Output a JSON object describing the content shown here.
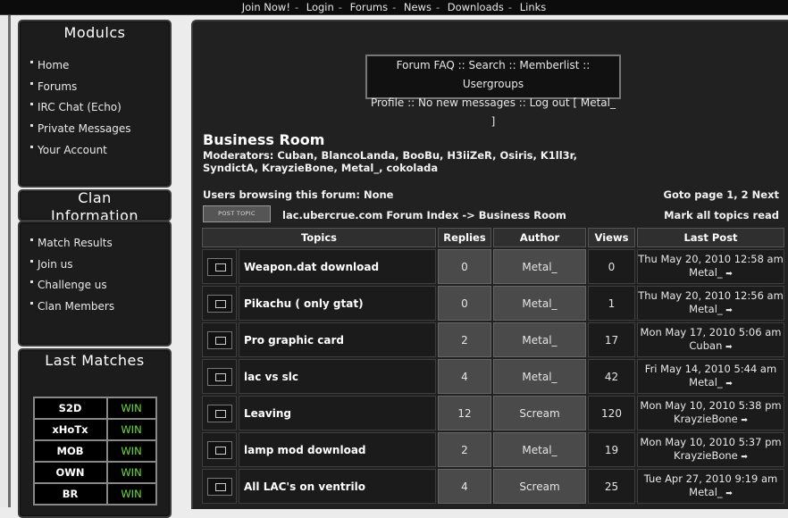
{
  "topnav": [
    "Join Now!",
    "Login",
    "Forums",
    "News",
    "Downloads",
    "Links"
  ],
  "modules": {
    "title": "Modulcs",
    "items": [
      "Home",
      "Forums",
      "IRC Chat (Echo)",
      "Private Messages",
      "Your Account"
    ]
  },
  "clan": {
    "title_line1": "Clan",
    "title_line2": "Information",
    "items": [
      "Match Results",
      "Join us",
      "Challenge us",
      "Clan Members"
    ]
  },
  "last_matches": {
    "title": "Last Matches",
    "rows": [
      {
        "team": "S2D",
        "result": "WIN"
      },
      {
        "team": "xHoTx",
        "result": "WIN"
      },
      {
        "team": "MOB",
        "result": "WIN"
      },
      {
        "team": "OWN",
        "result": "WIN"
      },
      {
        "team": "BR",
        "result": "WIN"
      }
    ]
  },
  "forum_links": {
    "line1": "Forum FAQ :: Search :: Memberlist :: Usergroups",
    "line2": "Profile :: No new messages :: Log out [ Metal_ ]"
  },
  "forum": {
    "title": "Business Room",
    "moderators": "Moderators: Cuban, BlancoLanda, BooBu, H3iiZeR, Osiris, K1ll3r, SyndictA, KrayzieBone, Metal_, cokolada",
    "users_browsing": "Users browsing this forum: None",
    "goto": "Goto page 1, 2  Next",
    "post_topic": "POST TOPIC",
    "breadcrumb": "lac.ubercrue.com Forum Index -> Business Room",
    "mark_all": "Mark all topics read"
  },
  "table": {
    "headers": [
      "Topics",
      "Replies",
      "Author",
      "Views",
      "Last Post"
    ],
    "rows": [
      {
        "title": "Weapon.dat download",
        "replies": "0",
        "author": "Metal_",
        "views": "0",
        "last_date": "Thu May 20, 2010 12:58 am",
        "last_user": "Metal_"
      },
      {
        "title": "Pikachu ( only gtat)",
        "replies": "0",
        "author": "Metal_",
        "views": "1",
        "last_date": "Thu May 20, 2010 12:56 am",
        "last_user": "Metal_"
      },
      {
        "title": "Pro graphic card",
        "replies": "2",
        "author": "Metal_",
        "views": "17",
        "last_date": "Mon May 17, 2010 5:06 am",
        "last_user": "Cuban"
      },
      {
        "title": "lac vs slc",
        "replies": "4",
        "author": "Metal_",
        "views": "42",
        "last_date": "Fri May 14, 2010 5:44 am",
        "last_user": "Metal_"
      },
      {
        "title": "Leaving",
        "replies": "12",
        "author": "Scream",
        "views": "120",
        "last_date": "Mon May 10, 2010 5:38 pm",
        "last_user": "KrayzieBone"
      },
      {
        "title": "lamp mod download",
        "replies": "2",
        "author": "Metal_",
        "views": "19",
        "last_date": "Mon May 10, 2010 5:37 pm",
        "last_user": "KrayzieBone"
      },
      {
        "title": "All LAC's on ventrilo",
        "replies": "4",
        "author": "Scream",
        "views": "25",
        "last_date": "Tue Apr 27, 2010 9:19 am",
        "last_user": "Metal_"
      }
    ]
  }
}
